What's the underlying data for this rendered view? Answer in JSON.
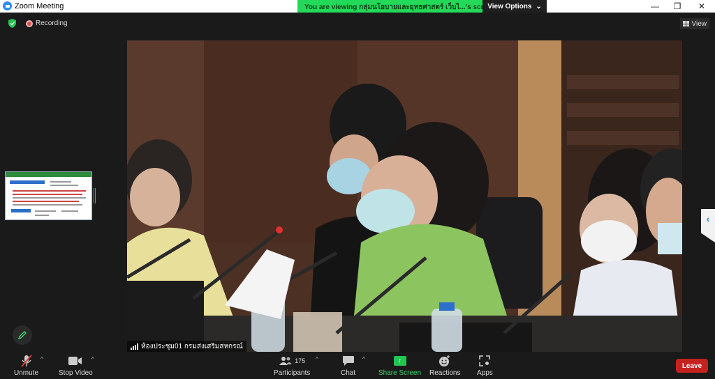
{
  "window": {
    "title": "Zoom Meeting",
    "minimize_glyph": "—",
    "maximize_glyph": "❐",
    "close_glyph": "✕"
  },
  "banner": {
    "message": "You are viewing กลุ่มนโยบายและยุทธศาสตร์ เว็บไ...'s screen",
    "options_label": "View Options",
    "options_caret": "⌄",
    "color": "#23d959"
  },
  "status": {
    "recording_label": "Recording",
    "view_label": "View"
  },
  "video": {
    "participant_name": "ห้องประชุม01 กรมส่งเสริมสหกรณ์"
  },
  "side_tab": {
    "glyph": "‹"
  },
  "toolbar": {
    "unmute_label": "Unmute",
    "stop_video_label": "Stop Video",
    "participants_label": "Participants",
    "participants_count": "175",
    "chat_label": "Chat",
    "share_label": "Share Screen",
    "reactions_label": "Reactions",
    "apps_label": "Apps",
    "leave_label": "Leave",
    "caret": "^",
    "share_color": "#23c552",
    "leave_color": "#c5221f"
  },
  "icons": {
    "app": "zoom-logo-icon",
    "security": "shield-icon",
    "recording": "record-dot-icon",
    "view": "grid-icon",
    "annotate": "pen-icon",
    "unmute": "mic-muted-icon",
    "video": "camera-icon",
    "participants": "people-icon",
    "chat": "chat-bubble-icon",
    "share": "share-arrow-icon",
    "reactions": "smiley-icon",
    "apps": "apps-icon"
  }
}
